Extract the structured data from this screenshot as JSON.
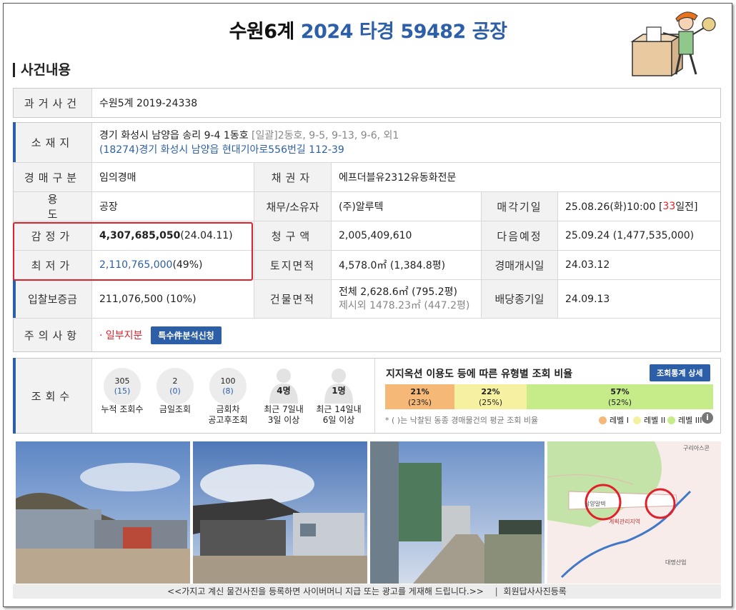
{
  "header": {
    "court": "수원6계",
    "case_no": "2024 타경 59482",
    "kind": "공장"
  },
  "section_title": "사건내용",
  "past_case": {
    "label": "과거사건",
    "value": "수원5계 2019-24338"
  },
  "location": {
    "label": "소재지",
    "address_main": "경기 화성시 남양읍 송리 9-4 1동호",
    "bulk": "[일괄]",
    "bulk_rest": "2동호, 9-5, 9-13, 9-6, 외1",
    "road_address": "(18274)경기 화성시  남양읍 현대기아로556번길  112-39"
  },
  "rows": {
    "auction_type": {
      "label": "경매구분",
      "value": "임의경매"
    },
    "creditor": {
      "label": "채권자",
      "value": "에프더블유2312유동화전문"
    },
    "usage": {
      "label": "용도",
      "value": "공장"
    },
    "debtor": {
      "label": "채무/소유자",
      "value": "(주)알루텍"
    },
    "sale_date": {
      "label": "매각기일",
      "value": "25.08.26(화)10:00 [",
      "days": "33",
      "suffix": "일전]"
    },
    "appraisal": {
      "label": "감정가",
      "value": "4,307,685,050",
      "date": " (24.04.11)"
    },
    "claim": {
      "label": "청구액",
      "value": "2,005,409,610"
    },
    "next": {
      "label": "다음예정",
      "value": "25.09.24 (1,477,535,000)"
    },
    "min_price": {
      "label": "최저가",
      "value": "2,110,765,000",
      "pct": " (49%)"
    },
    "land_area": {
      "label": "토지면적",
      "value": "4,578.0㎡ (1,384.8평)"
    },
    "start_date": {
      "label": "경매개시일",
      "value": "24.03.12"
    },
    "deposit": {
      "label": "입찰보증금",
      "value": "211,076,500 (10%)"
    },
    "building_area": {
      "label": "건물면적",
      "value1": "전체 2,628.6㎡ (795.2평)",
      "value2": "제시외 1478.23㎡ (447.2평)"
    },
    "dividend": {
      "label": "배당종기일",
      "value": "24.09.13"
    },
    "notice": {
      "label": "주의사항",
      "value": "· 일부지분",
      "button": "특수件분석신청"
    }
  },
  "views": {
    "label": "조회수",
    "items": [
      {
        "top": "305",
        "sub": "(15)",
        "caption1": "누적 조회수",
        "caption2": ""
      },
      {
        "top": "2",
        "sub": "(0)",
        "caption1": "금일조회",
        "caption2": ""
      },
      {
        "top": "100",
        "sub": "(8)",
        "caption1": "금회차",
        "caption2": "공고후조회"
      },
      {
        "top": "4명",
        "sub": "",
        "caption1": "최근 7일내",
        "caption2": "3일 이상"
      },
      {
        "top": "1명",
        "sub": "",
        "caption1": "최근 14일내",
        "caption2": "6일 이상"
      }
    ]
  },
  "ratio": {
    "title": "지지옥션 이용도 등에 따른 유형별 조회 비율",
    "button": "조회통계 상세",
    "bars": [
      {
        "pct": "21%",
        "sub": "(23%)",
        "color": "#f5b877",
        "share": 0.21
      },
      {
        "pct": "22%",
        "sub": "(25%)",
        "color": "#f6f1a0",
        "share": 0.22
      },
      {
        "pct": "57%",
        "sub": "(52%)",
        "color": "#c6ec8a",
        "share": 0.57
      }
    ],
    "note": "* ( )는 낙찰된 동종 경매물건의 평균 조회 비율",
    "legend": [
      "레벨 I",
      "레벨 II",
      "레벨 III"
    ]
  },
  "bottom": {
    "notice": "<<가지고 계신 물건사진을 등록하면 사이버머니 지급 또는 광고를 게재해 드립니다.>>",
    "link": "회원답사사진등록"
  },
  "map_labels": [
    "구리아스콘",
    "남양알텍",
    "계획관리지역",
    "대명산업"
  ]
}
